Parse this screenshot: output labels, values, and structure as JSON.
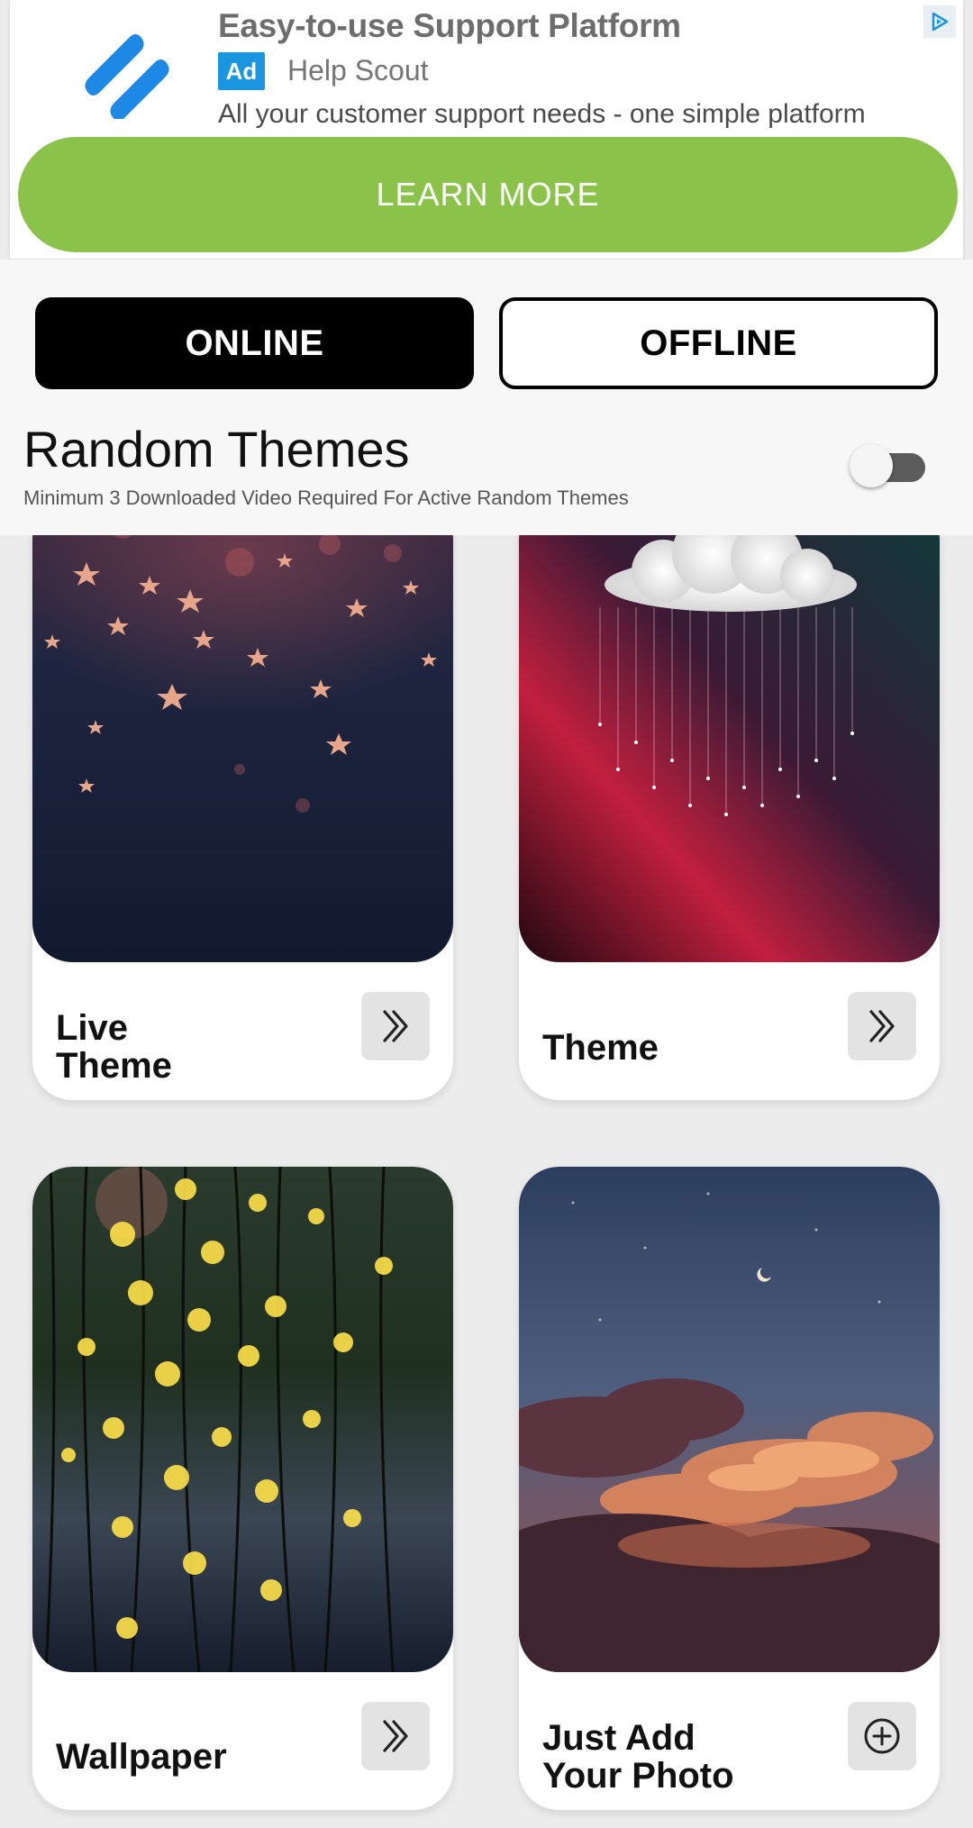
{
  "ad": {
    "title": "Easy-to-use Support Platform",
    "badge": "Ad",
    "advertiser": "Help Scout",
    "description": "All your customer support needs - one simple platform",
    "cta": "LEARN MORE",
    "cta_color": "#8bc34a",
    "logo_icon": "help-scout-logo",
    "choices_icon": "ad-choices-icon"
  },
  "mode_tabs": {
    "online": "ONLINE",
    "offline": "OFFLINE",
    "selected": "ONLINE"
  },
  "random_themes": {
    "title": "Random Themes",
    "subtitle": "Minimum 3 Downloaded Video Required For Active Random Themes",
    "enabled": false
  },
  "cards": [
    {
      "label": "Live\nTheme",
      "action_icon": "double-chevron-right-icon"
    },
    {
      "label": "Theme",
      "action_icon": "double-chevron-right-icon"
    },
    {
      "label": "Wallpaper",
      "action_icon": "double-chevron-right-icon"
    },
    {
      "label": "Just Add\nYour Photo",
      "action_icon": "plus-circle-icon"
    }
  ]
}
